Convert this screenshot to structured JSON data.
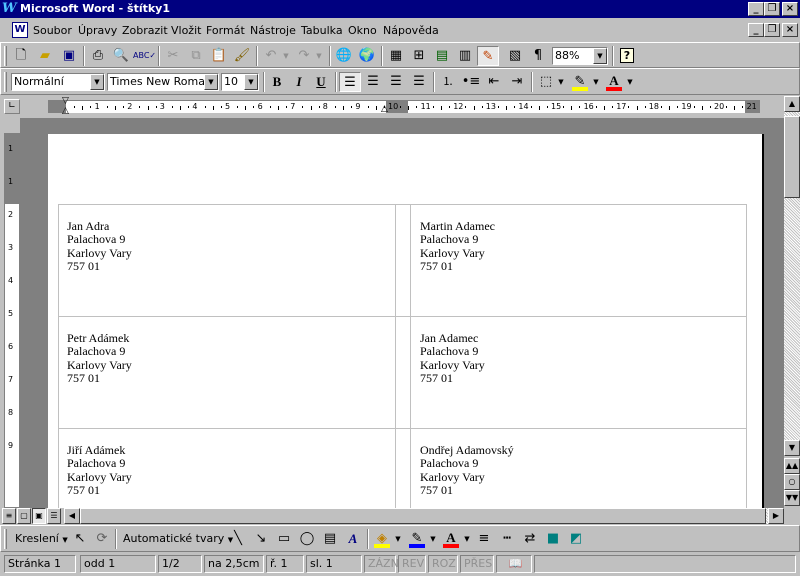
{
  "window": {
    "app_icon": "W",
    "title": "Microsoft Word - štítky1"
  },
  "menu": [
    "Soubor",
    "Úpravy",
    "Zobrazit",
    "Vložit",
    "Formát",
    "Nástroje",
    "Tabulka",
    "Okno",
    "Nápověda"
  ],
  "standard_toolbar": {
    "icons": [
      "new-document-icon",
      "open-folder-icon",
      "save-icon",
      "print-icon",
      "print-preview-icon",
      "spelling-icon",
      "cut-icon",
      "copy-icon",
      "paste-icon",
      "format-painter-icon",
      "undo-icon",
      "redo-icon",
      "insert-hyperlink-icon",
      "web-toolbar-icon",
      "tables-borders-icon",
      "insert-table-icon",
      "insert-excel-icon",
      "columns-icon",
      "drawing-icon",
      "document-map-icon",
      "show-formatting-icon",
      "help-icon"
    ],
    "zoom": "88%"
  },
  "formatting_toolbar": {
    "style": "Normální",
    "font": "Times New Roman",
    "size": "10",
    "bold": "B",
    "italic": "I",
    "underline": "U",
    "highlight_color": "#ffff00",
    "font_color": "#ff0000"
  },
  "ruler": {
    "numbers": [
      "1",
      "2",
      "3",
      "4",
      "5",
      "6",
      "7",
      "8",
      "9",
      "10",
      "11",
      "12",
      "13",
      "14",
      "15",
      "16",
      "17",
      "18",
      "19",
      "20",
      "21"
    ],
    "vertical_numbers": [
      "1",
      "1",
      "2",
      "3",
      "4",
      "5",
      "6",
      "7",
      "8",
      "9"
    ]
  },
  "labels": [
    {
      "name": "Jan Adra",
      "street": "Palachova 9",
      "city": "Karlovy Vary",
      "zip": "757 01"
    },
    {
      "name": "Martin Adamec",
      "street": "Palachova 9",
      "city": "Karlovy Vary",
      "zip": "757 01"
    },
    {
      "name": "Petr Adámek",
      "street": "Palachova 9",
      "city": "Karlovy Vary",
      "zip": "757 01"
    },
    {
      "name": "Jan Adamec",
      "street": "Palachova 9",
      "city": "Karlovy Vary",
      "zip": "757 01"
    },
    {
      "name": "Jiří Adámek",
      "street": "Palachova 9",
      "city": "Karlovy Vary",
      "zip": "757 01"
    },
    {
      "name": "Ondřej Adamovský",
      "street": "Palachova 9",
      "city": "Karlovy Vary",
      "zip": "757 01"
    }
  ],
  "drawing_toolbar": {
    "draw_menu": "Kreslení",
    "autoshapes": "Automatické tvary"
  },
  "status": {
    "page": "Stránka  1",
    "section": "odd  1",
    "pages": "1/2",
    "position": "na  2,5cm",
    "line": "ř.  1",
    "column": "sl.  1",
    "rec": "ZÁZN",
    "trk": "REV",
    "ext": "ROZ",
    "ovr": "PŘES"
  }
}
